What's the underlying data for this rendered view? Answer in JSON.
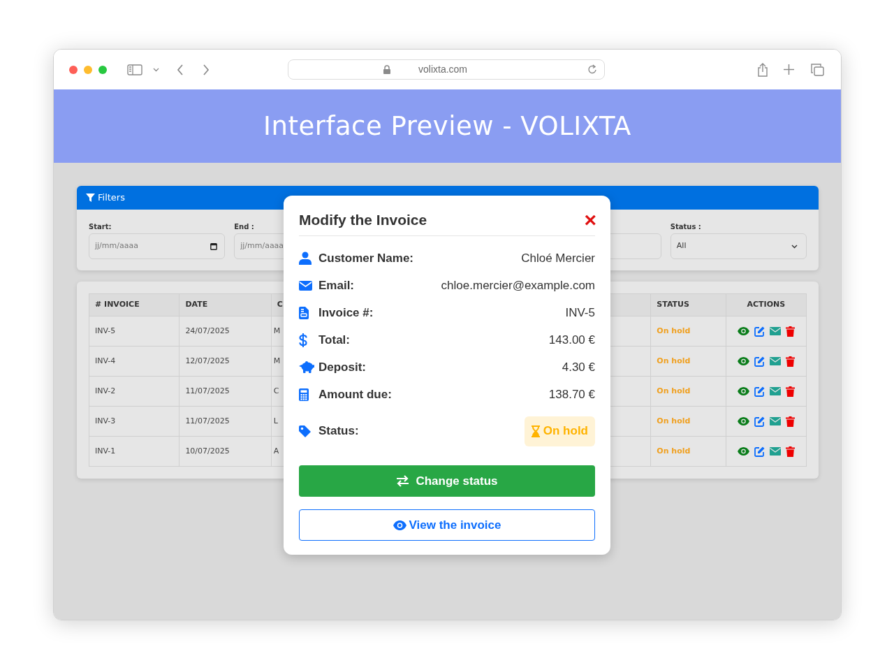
{
  "browser": {
    "url": "volixta.com"
  },
  "header": {
    "title": "Interface Preview - VOLIXTA"
  },
  "filters": {
    "title": "Filters",
    "fields": [
      {
        "kind": "date",
        "label": "Start:",
        "placeholder": "jj/mm/aaaa"
      },
      {
        "kind": "date_covered",
        "label": "End :",
        "placeholder": "jj/mm/aaaa"
      },
      {
        "kind": "blank"
      },
      {
        "kind": "select",
        "label": "Status :",
        "value": "All"
      }
    ]
  },
  "table": {
    "columns": [
      "# INVOICE",
      "DATE",
      "C",
      "STATUS",
      "ACTIONS"
    ],
    "rows": [
      {
        "invoice": "INV-5",
        "date": "24/07/2025",
        "column_3": "M",
        "status": "On hold"
      },
      {
        "invoice": "INV-4",
        "date": "12/07/2025",
        "column_3": "M",
        "status": "On hold"
      },
      {
        "invoice": "INV-2",
        "date": "11/07/2025",
        "column_3": "C",
        "status": "On hold"
      },
      {
        "invoice": "INV-3",
        "date": "11/07/2025",
        "column_3": "L",
        "status": "On hold"
      },
      {
        "invoice": "INV-1",
        "date": "10/07/2025",
        "column_3": "A",
        "status": "On hold"
      }
    ]
  },
  "modal": {
    "title": "Modify the Invoice",
    "close": "×",
    "rows": [
      {
        "kind": "person",
        "label": "Customer Name:",
        "value": "Chloé Mercier"
      },
      {
        "kind": "email",
        "label": "Email:",
        "value": "chloe.mercier@example.com"
      },
      {
        "kind": "document",
        "label": "Invoice #:",
        "value": "INV-5"
      },
      {
        "kind": "dollar",
        "label": "Total:",
        "value": "143.00 €"
      },
      {
        "kind": "piggy",
        "label": "Deposit:",
        "value": "4.30 €"
      },
      {
        "kind": "calculator",
        "label": "Amount due:",
        "value": "138.70 €"
      },
      {
        "kind": "tag",
        "label": "Status:",
        "badge": "On hold"
      }
    ],
    "primary_button": "Change status",
    "secondary_button": "View the invoice"
  }
}
